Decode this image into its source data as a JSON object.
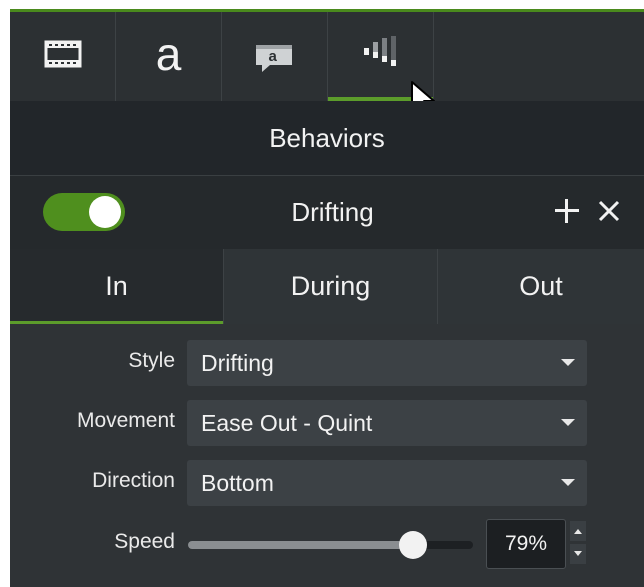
{
  "toolbar": {
    "tabs": [
      {
        "icon": "film-strip-icon",
        "label": ""
      },
      {
        "icon": "annotation-text-icon",
        "label": "a"
      },
      {
        "icon": "callout-bubble-icon",
        "label": "a"
      },
      {
        "icon": "behaviors-icon",
        "label": ""
      }
    ],
    "active_tab": 3
  },
  "section": {
    "title": "Behaviors"
  },
  "behavior": {
    "enabled": true,
    "name": "Drifting",
    "add_icon": "plus-icon",
    "remove_icon": "close-icon"
  },
  "phase_tabs": {
    "items": [
      "In",
      "During",
      "Out"
    ],
    "active": 0
  },
  "properties": {
    "style": {
      "label": "Style",
      "value": "Drifting"
    },
    "movement": {
      "label": "Movement",
      "value": "Ease Out - Quint"
    },
    "direction": {
      "label": "Direction",
      "value": "Bottom"
    },
    "speed": {
      "label": "Speed",
      "value_text": "79%",
      "fraction": 0.79
    }
  },
  "colors": {
    "accent_green": "#5c9c2b",
    "panel_bg": "#2f3336",
    "header_bg": "#22262a"
  }
}
